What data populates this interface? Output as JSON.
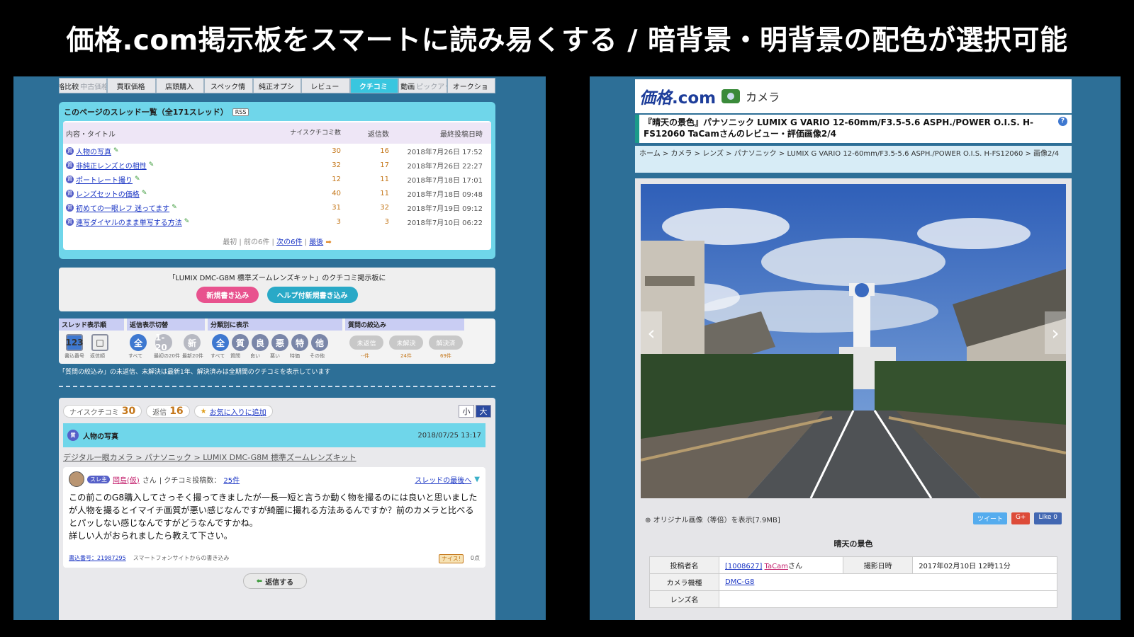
{
  "headline": "価格.com掲示板をスマートに読み易くする / 暗背景・明背景の配色が選択可能",
  "left": {
    "tabs": [
      {
        "label": "価格比較",
        "dim": "中古価格比"
      },
      {
        "label": "買取価格",
        "dim": ""
      },
      {
        "label": "店頭購入",
        "dim": ""
      },
      {
        "label": "スペック情",
        "dim": ""
      },
      {
        "label": "純正オプシ",
        "dim": ""
      },
      {
        "label": "レビュー",
        "dim": ""
      },
      {
        "label": "クチコミ",
        "dim": "",
        "active": true
      },
      {
        "label": "画像・動画",
        "dim": "ピックアップリ"
      },
      {
        "label": "オークショ",
        "dim": ""
      }
    ],
    "thread_list": {
      "heading": "このページのスレッド一覧（全171スレッド）",
      "tag": "RSS",
      "columns": [
        "内容・タイトル",
        "ナイスクチコミ数",
        "返信数",
        "最終投稿日時"
      ],
      "rows": [
        {
          "title": "人物の写真",
          "nice": "30",
          "replies": "16",
          "date": "2018年7月26日 17:52"
        },
        {
          "title": "非純正レンズとの相性",
          "nice": "32",
          "replies": "17",
          "date": "2018年7月26日 22:27"
        },
        {
          "title": "ポートレート撮り",
          "nice": "12",
          "replies": "11",
          "date": "2018年7月18日 17:01"
        },
        {
          "title": "レンズセットの価格",
          "nice": "40",
          "replies": "11",
          "date": "2018年7月18日 09:48"
        },
        {
          "title": "初めての一眼レフ 迷ってます",
          "nice": "31",
          "replies": "32",
          "date": "2018年7月19日 09:12"
        },
        {
          "title": "連写ダイヤルのまま単写する方法",
          "nice": "3",
          "replies": "3",
          "date": "2018年7月10日 06:22"
        }
      ],
      "pager": {
        "first": "最初",
        "prev": "前の6件",
        "next": "次の6件",
        "last": "最後"
      }
    },
    "cta": {
      "text": "「LUMIX DMC-G8M 標準ズームレンズキット」のクチコミ掲示板に",
      "new_post": "新規書き込み",
      "help_post": "ヘルプ付新規書き込み"
    },
    "filters": {
      "groups": [
        "スレッド表示順",
        "返信表示切替",
        "分類別に表示",
        "質問の絞込み"
      ],
      "sort_buttons": [
        "123",
        "□"
      ],
      "sort_subs": [
        "書込番号",
        "返信順"
      ],
      "reply_buttons": [
        "全",
        "1-20",
        "新"
      ],
      "reply_subs": [
        "すべて",
        "最初の20件",
        "最新20件"
      ],
      "category_buttons": [
        "全",
        "質",
        "良",
        "悪",
        "特",
        "他"
      ],
      "category_subs": [
        "すべて",
        "質問",
        "良い",
        "悪い",
        "特価",
        "その他"
      ],
      "question_buttons": [
        "未返信",
        "未解決",
        "解決済"
      ],
      "question_subs": [
        "--件",
        "24件",
        "69件"
      ]
    },
    "note": "「質問の絞込み」の未返信、未解決は最新1年、解決済みは全期間のクチコミを表示しています",
    "post": {
      "nice_label": "ナイスクチコミ",
      "nice_count": "30",
      "reply_label": "返信",
      "reply_count": "16",
      "fav": "お気に入りに追加",
      "size_small": "小",
      "size_large": "大",
      "title": "人物の写真",
      "date": "2018/07/25 13:17",
      "breadcrumb": "デジタル一眼カメラ > パナソニック > LUMIX DMC-G8M 標準ズームレンズキット",
      "author": "岡島(仮)",
      "author_suffix": "さん",
      "count_label": "| クチコミ投稿数：",
      "count": "25件",
      "level": "スレ主",
      "to_last": "スレッドの最後へ",
      "body": "この前このG8購入してさっそく撮ってきましたが一長一短と言うか動く物を撮るのには良いと思いましたが人物を撮るとイマイチ画質が悪い感じなんですが綺麗に撮れる方法あるんですか？前のカメラと比べるとパッしない感じなんですがどうなんですかね。\n詳しい人がおられましたら教えて下さい。",
      "post_no": "書込番号：21987295",
      "via": "スマートフォンサイトからの書き込み",
      "nice": "ナイス!",
      "nice_n": "0点",
      "reply_btn": "返信する"
    }
  },
  "right": {
    "logo": "価格",
    "logo_com": ".com",
    "category": "カメラ",
    "title": "『晴天の景色』パナソニック LUMIX G VARIO 12-60mm/F3.5-5.6 ASPH./POWER O.I.S. H-FS12060 TaCamさんのレビュー・評価画像2/4",
    "breadcrumb": "ホーム > カメラ > レンズ > パナソニック > LUMIX G VARIO 12-60mm/F3.5-5.6 ASPH./POWER O.I.S. H-FS12060 > 画像2/4",
    "original": "オリジナル画像（等倍）を表示[7.9MB]",
    "social": [
      {
        "label": "ツイート",
        "color": "#55acee"
      },
      {
        "label": "G+",
        "color": "#dd4b39"
      },
      {
        "label": "Like 0",
        "color": "#4267b2"
      }
    ],
    "photo_title": "晴天の景色",
    "meta": {
      "poster_label": "投稿者名",
      "poster_id": "[1008627]",
      "poster_name": "TaCam",
      "poster_suffix": "さん",
      "date_label": "撮影日時",
      "date": "2017年02月10日 12時11分",
      "camera_label": "カメラ機種",
      "camera": "DMC-G8",
      "lens_label": "レンズ名"
    }
  }
}
